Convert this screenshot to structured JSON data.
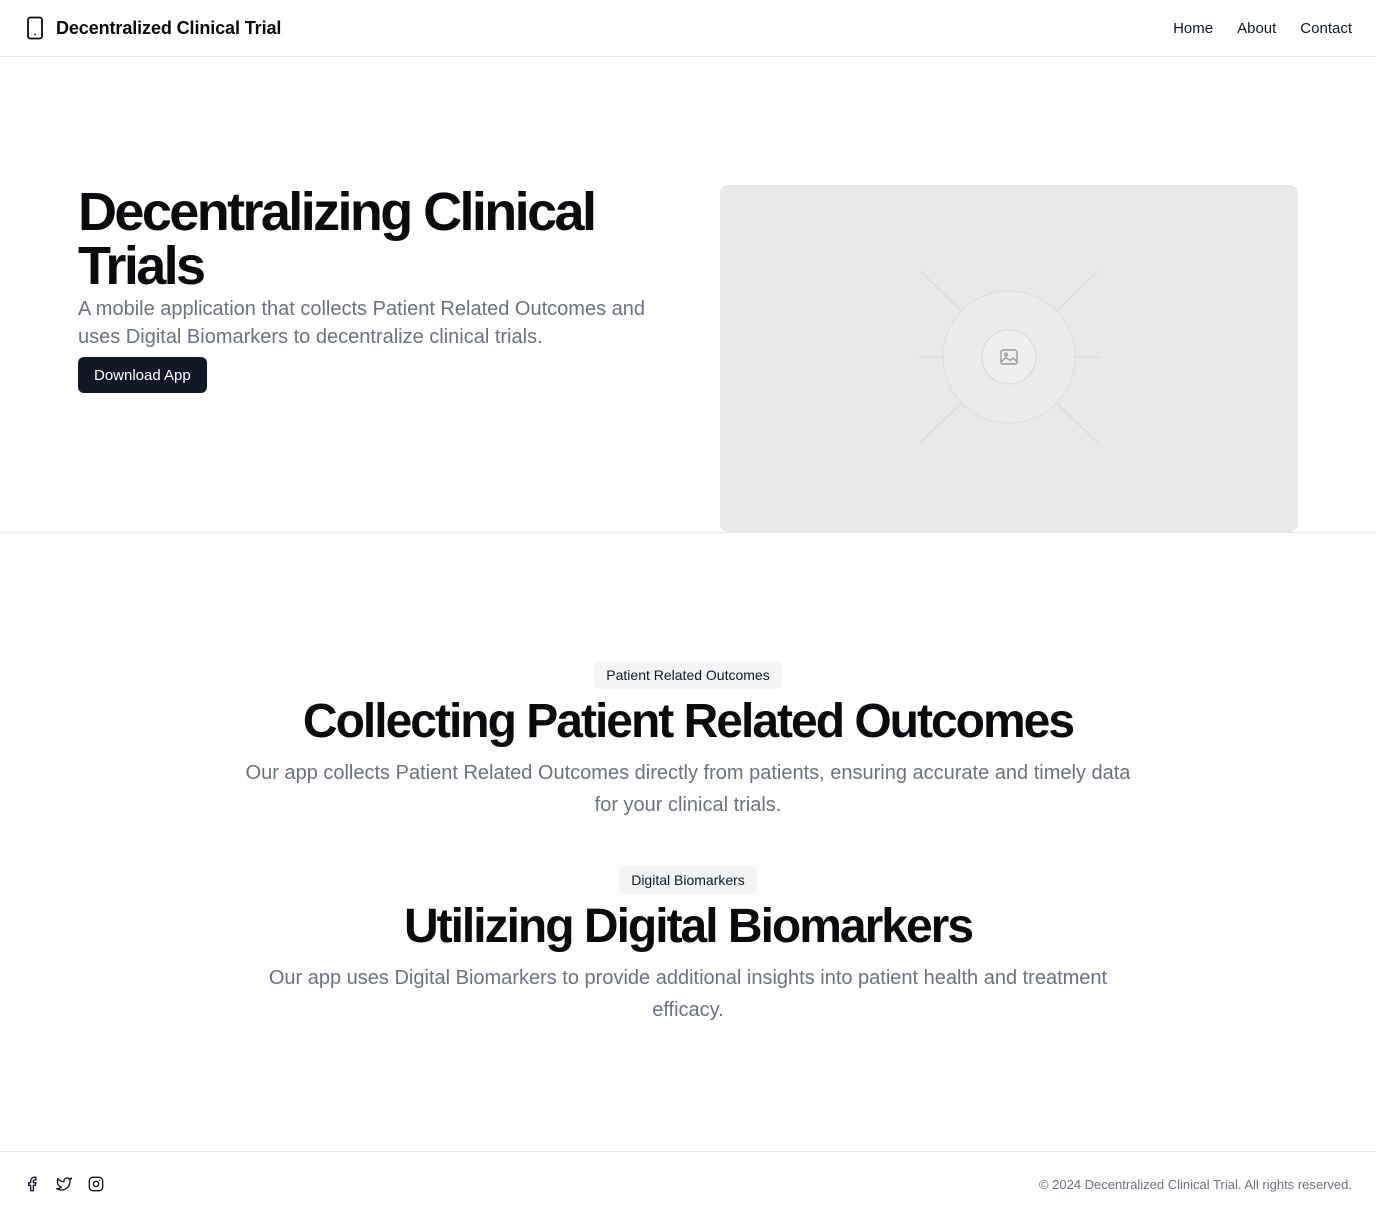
{
  "header": {
    "brand_title": "Decentralized Clinical Trial",
    "brand_icon": "smartphone-icon",
    "nav": [
      "Home",
      "About",
      "Contact"
    ]
  },
  "hero": {
    "title": "Decentralizing Clinical Trials",
    "subtitle": "A mobile application that collects Patient Related Outcomes and uses Digital Biomarkers to decentralize clinical trials.",
    "cta_label": "Download App",
    "image_icon": "image-placeholder-icon"
  },
  "features": [
    {
      "badge": "Patient Related Outcomes",
      "title": "Collecting Patient Related Outcomes",
      "description": "Our app collects Patient Related Outcomes directly from patients, ensuring accurate and timely data for your clinical trials."
    },
    {
      "badge": "Digital Biomarkers",
      "title": "Utilizing Digital Biomarkers",
      "description": "Our app uses Digital Biomarkers to provide additional insights into patient health and treatment efficacy."
    }
  ],
  "footer": {
    "social_icons": [
      "facebook-icon",
      "twitter-icon",
      "instagram-icon"
    ],
    "copyright": "© 2024 Decentralized Clinical Trial. All rights reserved."
  },
  "colors": {
    "primary_button": "#111827",
    "muted_text": "#6b7280",
    "border": "#e5e7eb",
    "badge_bg": "#f3f4f6",
    "placeholder_bg": "#e8e8e8"
  }
}
